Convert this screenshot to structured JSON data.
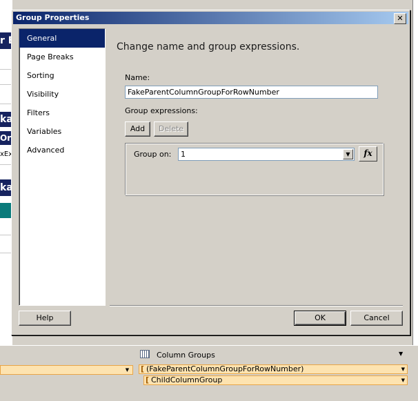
{
  "background": {
    "fragments": [
      "r E",
      "kar",
      "Or",
      "xEx",
      "kar"
    ]
  },
  "dialog": {
    "title": "Group Properties",
    "close_label": "✕",
    "nav": [
      {
        "label": "General",
        "active": true
      },
      {
        "label": "Page Breaks",
        "active": false
      },
      {
        "label": "Sorting",
        "active": false
      },
      {
        "label": "Visibility",
        "active": false
      },
      {
        "label": "Filters",
        "active": false
      },
      {
        "label": "Variables",
        "active": false
      },
      {
        "label": "Advanced",
        "active": false
      }
    ],
    "heading": "Change name and group expressions.",
    "name_label": "Name:",
    "name_value": "FakeParentColumnGroupForRowNumber",
    "group_expressions_label": "Group expressions:",
    "add_label": "Add",
    "delete_label": "Delete",
    "group_on_label": "Group on:",
    "group_on_value": "1",
    "fx_label": "fx",
    "help_label": "Help",
    "ok_label": "OK",
    "cancel_label": "Cancel"
  },
  "grouping_pane": {
    "column_groups_label": "Column Groups",
    "column_groups": [
      "(FakeParentColumnGroupForRowNumber)",
      "ChildColumnGroup"
    ]
  },
  "colors": {
    "title_gradient_start": "#0a246a",
    "nav_selected": "#0a246a",
    "group_row_fill": "#fde3b0",
    "group_row_border": "#e8a446"
  },
  "icons": [
    "close-icon",
    "chevron-down-icon",
    "fx-icon",
    "column-groups-icon"
  ]
}
